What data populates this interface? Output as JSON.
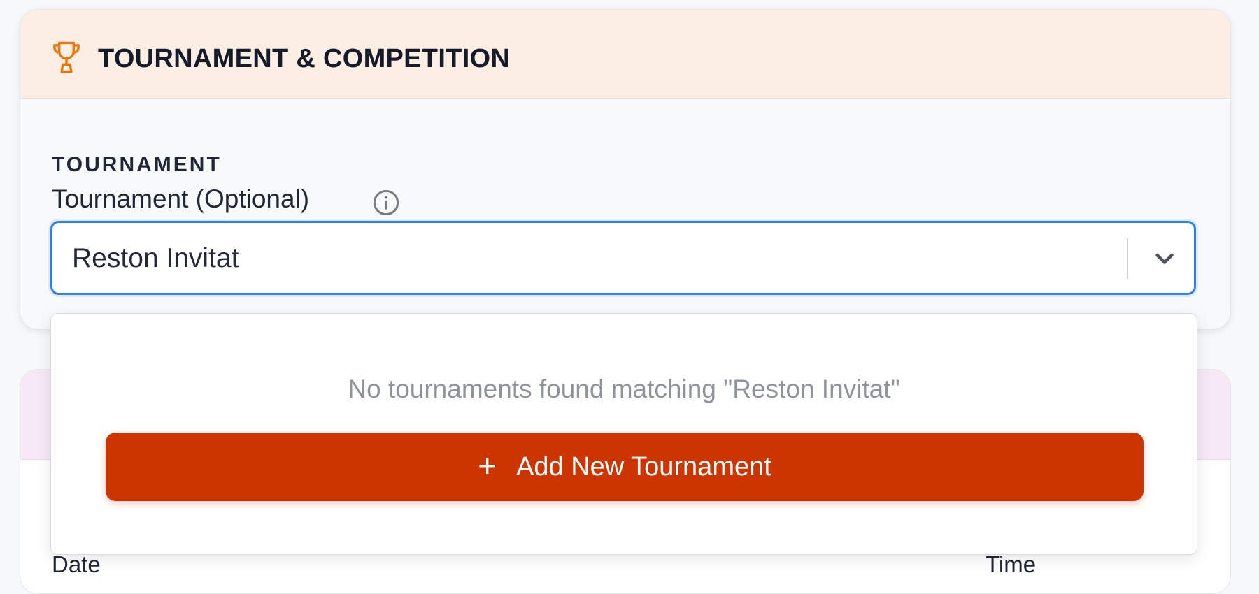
{
  "card": {
    "title": "TOURNAMENT & COMPETITION",
    "icon": "trophy-icon",
    "section_label": "TOURNAMENT",
    "field_label": "Tournament (Optional)",
    "info_icon": "info-icon"
  },
  "combobox": {
    "value": "Reston Invitat",
    "toggle_icon": "chevron-down-icon"
  },
  "dropdown": {
    "empty_message": "No tournaments found matching \"Reston Invitat\"",
    "add_button": {
      "icon_glyph": "+",
      "label": "Add New Tournament"
    }
  },
  "second_card": {
    "columns": [
      "Date",
      "Time"
    ]
  },
  "colors": {
    "accent": "#2f7fe8",
    "primary_button": "#cc3500",
    "trophy": "#e8780d",
    "header_bg": "#fbeee3",
    "second_header_bg": "#f6e9f5"
  }
}
